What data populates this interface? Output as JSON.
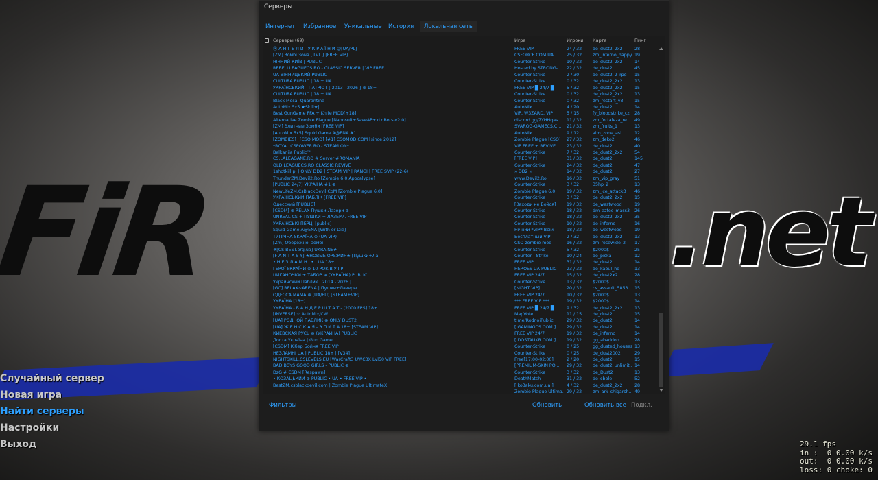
{
  "main_menu": {
    "items": [
      "Случайный сервер",
      "Новая игра",
      "Найти серверы",
      "Настройки",
      "Выход"
    ],
    "active_index": 2
  },
  "hud": {
    "fps": "29.1 fps",
    "in": "in :  0 0.00 k/s",
    "out": "out:  0 0.00 k/s",
    "loss": "loss: 0 choke: 0"
  },
  "dialog": {
    "title": "Серверы",
    "tabs": [
      "Интернет",
      "Избранное",
      "Уникальные",
      "История",
      "Локальная сеть"
    ],
    "active_tab": 4,
    "columns": {
      "servers": "Серверы (69)",
      "game": "Игра",
      "players": "Игроки",
      "map": "Карта",
      "ping": "Пинг"
    },
    "footer": {
      "filters": "Фильтры",
      "refresh": "Обновить",
      "refresh_all": "Обновить все",
      "connect": "Подкл."
    }
  },
  "servers": [
    [
      "ⓐ А Н Г Е Л И - У К Р А Ї Н И ☺[UA/PL]",
      "FREE VIP",
      "24 / 32",
      "de_dust2_2x2",
      "28"
    ],
    [
      "[ZM] Зомбі Зона [ LVL ] [FREE VIP]",
      "CSFORCE.COM.UA",
      "25 / 32",
      "zm_inferno_happy",
      "19"
    ],
    [
      "НІЧНИЙ КИЇВ | PUBLIC",
      "Counter-Strike",
      "10 / 32",
      "de_dust2_2x2",
      "14"
    ],
    [
      "REBELLLEAGUECS.RO - CLASSIC SERVER | VIP FREE",
      "Hosted by STRONG-...",
      "22 / 32",
      "de_dust2",
      "45"
    ],
    [
      "UA ВІННИЦЬКИЙ PUBLIC",
      "Counter-Strike",
      "2 / 30",
      "de_dust2_2_rpg",
      "15"
    ],
    [
      "CULTURA PUBLIC | 18 + UA",
      "Counter-Strike",
      "0 / 32",
      "de_dust2_2x2",
      "13"
    ],
    [
      "УКРАЇНСЬКИЙ - ПАТРІОТ [ 2013 - 2026 ] ⊕ 18+",
      "FREE VIP █ 24/7 █",
      "5 / 32",
      "de_dust2_2x2",
      "15"
    ],
    [
      "CULTURA PUBLIC | 18 + UA",
      "Counter-Strike",
      "0 / 32",
      "de_dust2_2x2",
      "13"
    ],
    [
      "Black Mesa: Quarantine",
      "Counter-Strike",
      "0 / 32",
      "zm_restart_v3",
      "15"
    ],
    [
      "AutoMix 5x5 ★Skill★|",
      "AutoMix",
      "4 / 20",
      "de_dust2",
      "14"
    ],
    [
      "Best GunGame FFA + Knife MOD[+18]",
      "VIP, W3ZARD, VIP",
      "5 / 15",
      "fy_bloodstrike_cz",
      "28"
    ],
    [
      "Alternative Zombie Plague [Nanosuit+SaveAP+xLdBots-v2.0]",
      "discord.gg/7YHHqas...",
      "11 / 32",
      "zm_fortaleza_re",
      "49"
    ],
    [
      "[ZM] Элитные Зомби [FREE VIP]",
      "SVAROG-GAMECS.C...",
      "21 / 32",
      "zm_fruits_1",
      "13"
    ],
    [
      "[AutoMix 5x5] Squid Game A@ENA #1",
      "AutoMix",
      "9 / 12",
      "aim_zone_asl",
      "12"
    ],
    [
      "[ZOMBIES]+[CSO MOD] [#1] CSOMOD.COM [since 2012]",
      "Zombie Plague [CSO]",
      "27 / 32",
      "zm_deko2",
      "46"
    ],
    [
      "*ROYAL.CSPOWER.RO - STEAM ON*",
      "VIP FREE + REVIVE",
      "23 / 32",
      "de_dust2",
      "40"
    ],
    [
      "Balkanija Public™",
      "Counter-Strike",
      "7 / 32",
      "de_dust2_2x2",
      "54"
    ],
    [
      "CS.LALEAGANE.RO # Server #ROMANIA",
      "[FREE VIP]",
      "31 / 32",
      "de_dust2",
      "145"
    ],
    [
      "OLD.LEAGUECS.RO CLASSIC REVIVE",
      "Counter-Strike",
      "24 / 32",
      "de_dust2",
      "47"
    ],
    [
      "1shotkill.pl | ONLY DD2 | STEAM VIP | RANGI | FREE SVIP (22-6)",
      "» DD2 «",
      "14 / 32",
      "de_dust2",
      "27"
    ],
    [
      "ThunderZM.Devil2.Ro [Zombie 6.0 Apocalypse]",
      "www.Devil2.Ro",
      "16 / 32",
      "zm_vip_gray",
      "51"
    ],
    [
      "[PUBLIC 24/7] УКРАЇНА #1 ⊕",
      "Counter-Strike",
      "3 / 32",
      "35hp_2",
      "13"
    ],
    [
      "NewLifeZM.CsBlackDevil.CoM [Zombie Plague 6.0]",
      "Zombie Plague 6.0",
      "19 / 32",
      "zm_ice_attack3",
      "46"
    ],
    [
      "УКРАЇНСЬКИЙ ПАБЛІК [FREE VIP]",
      "Counter-Strike",
      "3 / 32",
      "de_dust2_2x2",
      "15"
    ],
    [
      "Одесский [PUBLIC]",
      "[Заходи не Бойся]",
      "19 / 32",
      "de_westwood",
      "19"
    ],
    [
      "[CSDM] ⊕ RELAX Пушки Лазери ⊕",
      "Counter-Strike",
      "18 / 32",
      "dm_aztec_mass3",
      "26"
    ],
    [
      "UNREAL CS + ПУШКИ + ЛАЗЕРИ. FREE VIP",
      "Counter-Strike",
      "18 / 32",
      "de_dust2_2x2",
      "35"
    ],
    [
      "УКРАЇНСЬКІ ПЕРЦІ [public]",
      "Counter-Strike",
      "10 / 32",
      "de_inferno",
      "16"
    ],
    [
      "Squid Game A@ENA [With or Die]",
      "Нічний *VIP* Всім",
      "18 / 32",
      "de_westwood",
      "19"
    ],
    [
      "ТИПІЧНА УКРАЇНА ⊕ (UA VIP)",
      "Бесплатный VIP",
      "2 / 32",
      "de_dust2_2x2",
      "13"
    ],
    [
      "[Zm] Обережно, зомбі!",
      "CSO zombie mod",
      "16 / 32",
      "zm_rosewide_2",
      "17"
    ],
    [
      "#[CS-BEST.org.ua] UKRAINE#",
      "Counter-Strike",
      "5 / 32",
      "$2000$",
      "25"
    ],
    [
      "[F A N T A S Y] ★НОВЫЕ ОРУЖИЯ★ [Пушки+Ла",
      "Counter - Strike",
      "10 / 24",
      "de_piska",
      "12"
    ],
    [
      "• Н Е З Л А М Н І • | UA 18+",
      "FREE VIP",
      "31 / 32",
      "de_dust2",
      "14"
    ],
    [
      "ГЕРОЇ УКРАЇНИ ⊕ 10 РОКІВ У ГРІ",
      "HEROES UA PUBLIC",
      "23 / 32",
      "de_kabul_hd",
      "13"
    ],
    [
      "ЦИГАНОЧКИ + ТАБОР ⊕ (УКРАЇНА) PUBLIC",
      "FREE VIP 24/7",
      "15 / 32",
      "de_dust2x2",
      "28"
    ],
    [
      "Украинский Паблик | 2014 - 2026 |",
      "Counter-Strike",
      "13 / 32",
      "$2000$",
      "13"
    ],
    [
      "[GC] RELAX~ARENA | Пушки+Лазеры",
      "[NIGHT VIP]",
      "20 / 32",
      "cs_assault_5853",
      "15"
    ],
    [
      "ОДЕССА МАМА ⊕ (UA/EU) [STEAM+VIP]",
      "FREE VIP 24/7",
      "10 / 32",
      "$2000$",
      "13"
    ],
    [
      "УКРАЇНА [18+]",
      "*** FREE VIP ***",
      "19 / 32",
      "$2000$",
      "14"
    ],
    [
      "УКРАЇНА - Б А Н Д Е Р Ш Т А Т - [2000 FPS] 18+",
      "FREE VIP █ 24/7 █",
      "9 / 32",
      "de_dust2_2x2",
      "13"
    ],
    [
      "[INVERSE] ☆ AutoMix/CW",
      "MapVote",
      "11 / 15",
      "de_dust2",
      "15"
    ],
    [
      "[UA] РОДНОЙ ПАБЛИК ⊕ ONLY DUST2",
      "t.me/RodnoiPublic",
      "29 / 32",
      "de_dust2",
      "14"
    ],
    [
      "[UA] Ж Е Н С К А Я - Э П И Т А 18+ [STEAM VIP]",
      "[ GAMINGCS.COM ]",
      "29 / 32",
      "de_dust2",
      "14"
    ],
    [
      "КИЕВСКАЯ РУСЬ ⊕ (УКРАИНА) PUBLIC",
      "FREE VIP 24/7",
      "19 / 32",
      "de_inferno",
      "14"
    ],
    [
      "Доста Україна | Gun Game",
      "[ DOSTAUKR.COM ]",
      "19 / 32",
      "gg_abaddon",
      "28"
    ],
    [
      "[CSDM] Кібер Бойня FREE VIP",
      "Counter-Strike",
      "0 / 25",
      "gg_dusted_houses",
      "13"
    ],
    [
      "НЕЗЛАМНІ UA | PUBLIC 18+ | [V34]",
      "Counter-Strike",
      "0 / 25",
      "de_dust2002",
      "29"
    ],
    [
      "NIGHTSKILL.CSLEVELS.EU [WarCraft3 UWC3X Lvl50 VIP FREE]",
      "Free[17:00-02:00]",
      "2 / 20",
      "de_dust2",
      "15"
    ],
    [
      "BAD BOYS  GOOD GIRLS - PUBLIC ⊕",
      "[PREMIUM-SKIN PO...",
      "29 / 32",
      "de_dust2_unlimit...",
      "14"
    ],
    [
      "DzG # CSDM [Respawn]",
      "Counter-Strike",
      "3 / 32",
      "de_Dust2",
      "13"
    ],
    [
      "• КОЗАЦЬКИЙ ⊕ PUBLIC • UA • FREE VIP •",
      "DeathMatch",
      "31 / 32",
      "de_cbble",
      "52"
    ],
    [
      "BestZM.csblackdevil.com | Zombie Plague UltimateX",
      "[ ko3aku.com.ua ]",
      "4 / 32",
      "de_dust2_2x2",
      "28"
    ],
    [
      "",
      "Zombie Plague Ultima...",
      "29 / 32",
      "zm_ark_shigarsh...",
      "49"
    ]
  ]
}
